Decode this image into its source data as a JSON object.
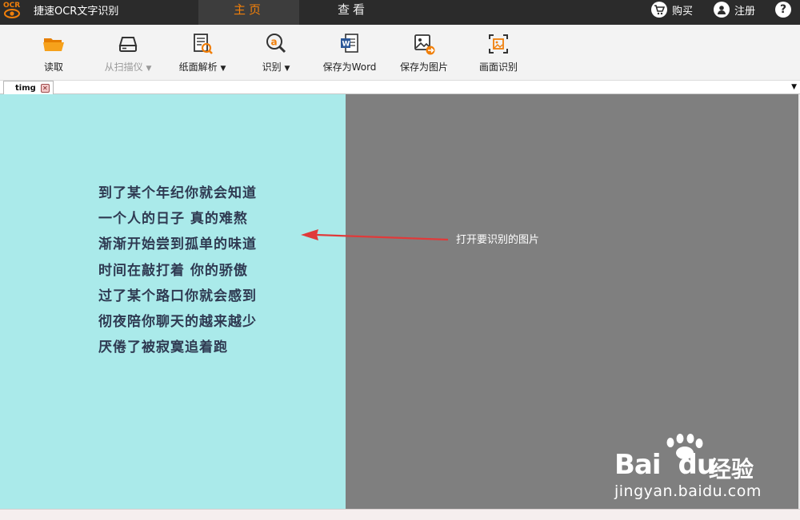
{
  "titlebar": {
    "logo_text": "OCR",
    "app_title": "捷速OCR文字识别",
    "tabs": [
      {
        "label": "主页",
        "active": true
      },
      {
        "label": "查看",
        "active": false
      }
    ],
    "buy_label": "购买",
    "register_label": "注册",
    "help_icon": "help-icon",
    "active_color": "#f07f0a"
  },
  "toolbar": {
    "items": [
      {
        "label": "读取",
        "icon": "folder-open-icon",
        "enabled": true
      },
      {
        "label": "从扫描仪",
        "icon": "scanner-icon",
        "enabled": false,
        "dropdown": true
      },
      {
        "label": "纸面解析",
        "icon": "page-search-icon",
        "enabled": true,
        "dropdown": true
      },
      {
        "label": "识别",
        "icon": "recognize-icon",
        "enabled": true,
        "dropdown": true
      },
      {
        "label": "保存为Word",
        "icon": "word-icon",
        "enabled": true
      },
      {
        "label": "保存为图片",
        "icon": "save-image-icon",
        "enabled": true
      },
      {
        "label": "画面识别",
        "icon": "screen-capture-icon",
        "enabled": true
      }
    ],
    "caret": "▼"
  },
  "document": {
    "tab_label": "timg",
    "close_glyph": "✕",
    "strip_caret": "▼"
  },
  "image_text": {
    "lines": [
      "到了某个年纪你就会知道",
      "一个人的日子 真的难熬",
      "渐渐开始尝到孤单的味道",
      "时间在敲打着 你的骄傲",
      "过了某个路口你就会感到",
      "彻夜陪你聊天的越来越少",
      "厌倦了被寂寞追着跑"
    ]
  },
  "annotation": {
    "text": "打开要识别的图片",
    "arrow_color": "#e03a3a"
  },
  "watermark": {
    "brand": "Bai",
    "brand_tail": "du",
    "brand_cn": "经验",
    "url": "jingyan.baidu.com"
  },
  "colors": {
    "left_pane": "#aaeaea",
    "right_pane": "#7f7f7f",
    "titlebar": "#2b2b2b"
  }
}
